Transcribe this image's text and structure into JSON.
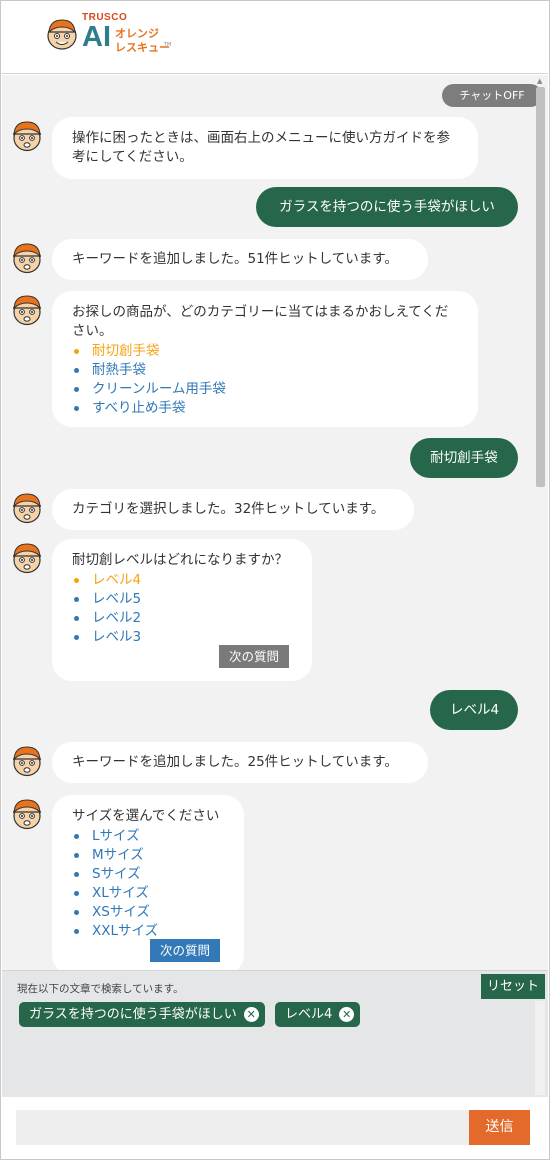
{
  "logo": {
    "brand": "TRUSCO",
    "ai": "AI",
    "sub_line1": "オレンジ",
    "sub_line2": "レスキュー",
    "tm": "TM"
  },
  "chat": {
    "chat_off_label": "チャットOFF",
    "messages": [
      {
        "role": "bot",
        "text": "操作に困ったときは、画面右上のメニューに使い方ガイドを参考にしてください。"
      },
      {
        "role": "user",
        "text": "ガラスを持つのに使う手袋がほしい"
      },
      {
        "role": "bot",
        "text": "キーワードを追加しました。51件ヒットしています。"
      },
      {
        "role": "bot",
        "text": "お探しの商品が、どのカテゴリーに当てはまるかおしえてください。",
        "options": [
          "耐切創手袋",
          "耐熱手袋",
          "クリーンルーム用手袋",
          "すべり止め手袋"
        ],
        "selected": "耐切創手袋"
      },
      {
        "role": "user",
        "text": "耐切創手袋"
      },
      {
        "role": "bot",
        "text": "カテゴリを選択しました。32件ヒットしています。"
      },
      {
        "role": "bot",
        "text": "耐切創レベルはどれになりますか？",
        "options": [
          "レベル4",
          "レベル5",
          "レベル2",
          "レベル3"
        ],
        "selected": "レベル4",
        "next_label": "次の質問"
      },
      {
        "role": "user",
        "text": "レベル4"
      },
      {
        "role": "bot",
        "text": "キーワードを追加しました。25件ヒットしています。"
      },
      {
        "role": "bot",
        "text": "サイズを選んでください",
        "options": [
          "Lサイズ",
          "Mサイズ",
          "Sサイズ",
          "XLサイズ",
          "XSサイズ",
          "XXLサイズ"
        ],
        "selected": null,
        "next_label": "次の質問"
      }
    ]
  },
  "search_conditions": {
    "label": "現在以下の文章で検索しています。",
    "reset_label": "リセット",
    "chips": [
      "ガラスを持つのに使う手袋がほしい",
      "レベル4"
    ],
    "chip_remove_icon": "close-circle-icon"
  },
  "input": {
    "placeholder": "",
    "value": "",
    "send_label": "送信"
  },
  "colors": {
    "user_bubble": "#26664a",
    "option_link": "#2f78b8",
    "option_selected": "#f5a214",
    "send_button": "#e36a2b",
    "next_button_grey": "#7a7a7a",
    "next_button_blue": "#3479b7"
  }
}
